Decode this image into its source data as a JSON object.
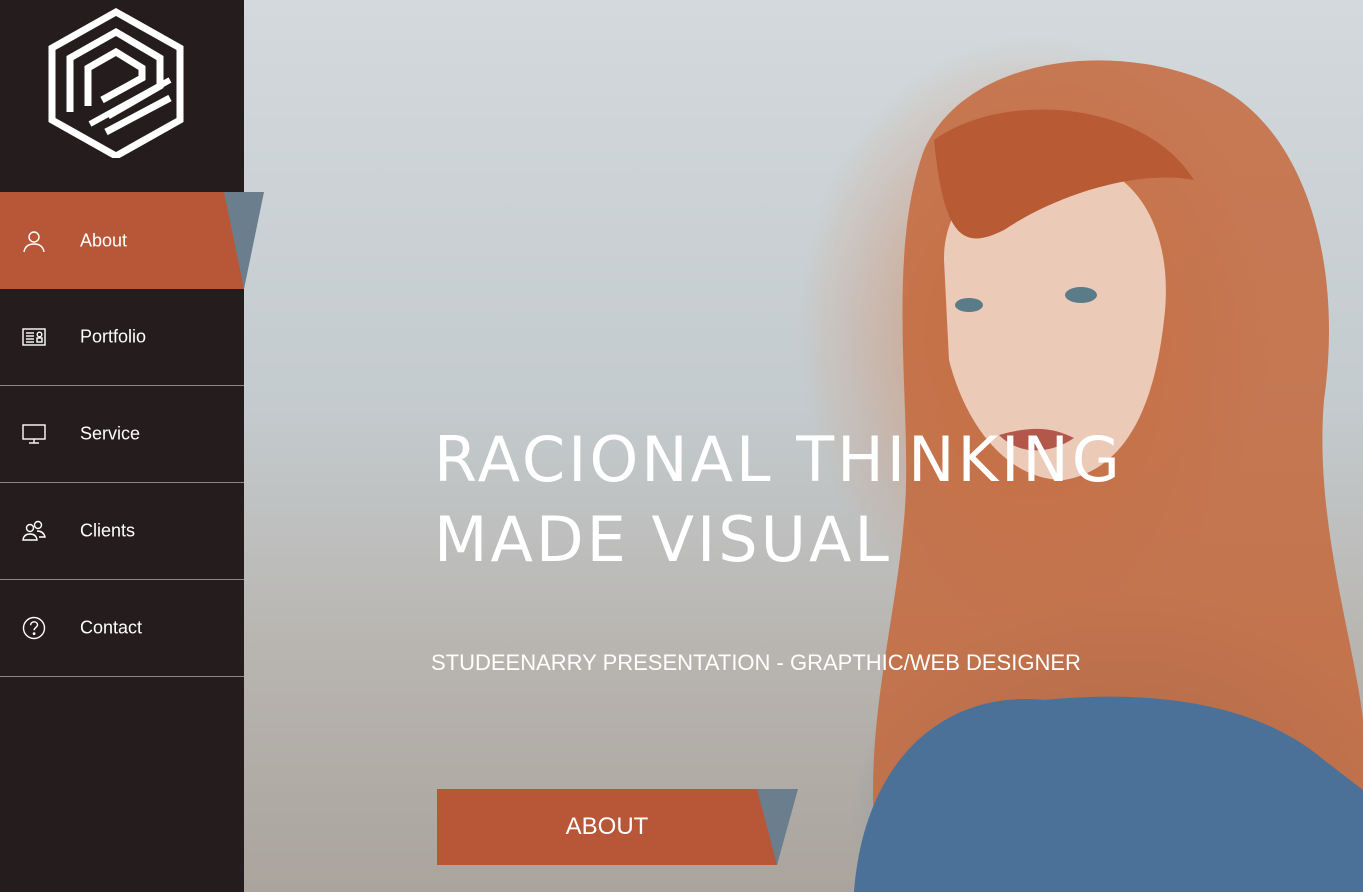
{
  "sidebar": {
    "logo_icon": "hexagon-logo-icon",
    "items": [
      {
        "label": "About",
        "icon": "user-icon",
        "active": true
      },
      {
        "label": "Portfolio",
        "icon": "portfolio-icon",
        "active": false
      },
      {
        "label": "Service",
        "icon": "monitor-icon",
        "active": false
      },
      {
        "label": "Clients",
        "icon": "users-icon",
        "active": false
      },
      {
        "label": "Contact",
        "icon": "question-circle-icon",
        "active": false
      }
    ]
  },
  "hero": {
    "headline_line1": "RACIONAL THINKING",
    "headline_line2": "MADE VISUAL",
    "subtitle": "STUDEENARRY PRESENTATION - GRAPTHIC/WEB DESIGNER",
    "cta_label": "ABOUT"
  },
  "colors": {
    "sidebar_bg": "#251d1d",
    "accent": "#b85738",
    "tab_slate": "#6a7e8d",
    "text": "#ffffff"
  }
}
